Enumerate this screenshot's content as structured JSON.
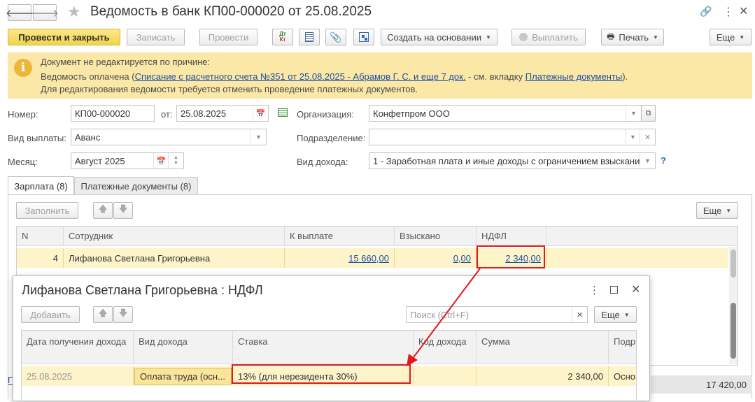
{
  "window": {
    "title": "Ведомость в банк КП00-000020 от 25.08.2025"
  },
  "toolbar": {
    "post_close": "Провести и закрыть",
    "save": "Записать",
    "post": "Провести",
    "create_based": "Создать на основании",
    "pay": "Выплатить",
    "print": "Печать",
    "more": "Еще"
  },
  "notice": {
    "line1": "Документ не редактируется по причине:",
    "line2_prefix": "Ведомость оплачена (",
    "line2_link": "Списание с расчетного счета №351 от 25.08.2025 - Абрамов Г. С. и еще 7 док.",
    "line2_mid": " - см. вкладку ",
    "line2_link2": "Платежные документы",
    "line2_suffix": ").",
    "line3": "Для редактирования ведомости требуется отменить проведение платежных документов."
  },
  "form": {
    "number_label": "Номер:",
    "number_value": "КП00-000020",
    "date_label": "от:",
    "date_value": "25.08.2025",
    "org_label": "Организация:",
    "org_value": "Конфетпром ООО",
    "payment_type_label": "Вид выплаты:",
    "payment_type_value": "Аванс",
    "subdivision_label": "Подразделение:",
    "subdivision_value": "",
    "month_label": "Месяц:",
    "month_value": "Август 2025",
    "income_type_label": "Вид дохода:",
    "income_type_value": "1 - Заработная плата и иные доходы с ограничением взыскания",
    "help": "?"
  },
  "tabs": [
    {
      "label": "Зарплата (8)"
    },
    {
      "label": "Платежные документы (8)"
    }
  ],
  "table_toolbar": {
    "fill": "Заполнить",
    "more": "Еще"
  },
  "table": {
    "columns": [
      "N",
      "Сотрудник",
      "К выплате",
      "Взыскано",
      "НДФЛ"
    ],
    "row": {
      "n": "4",
      "employee": "Лифанова Светлана Григорьевна",
      "to_pay": "15 660,00",
      "withheld": "0,00",
      "ndfl": "2 340,00"
    }
  },
  "footer": {
    "total": "17 420,00",
    "left_link": "Г"
  },
  "dialog": {
    "title": "Лифанова Светлана Григорьевна : НДФЛ",
    "add": "Добавить",
    "search_placeholder": "Поиск (Ctrl+F)",
    "more": "Еще",
    "columns": [
      "Дата получения дохода",
      "Вид дохода",
      "Ставка",
      "Код дохода",
      "Сумма",
      "Подр"
    ],
    "row": {
      "date": "25.08.2025",
      "income_type": "Оплата труда (осн...",
      "rate": "13% (для нерезидента 30%)",
      "code": "",
      "sum": "2 340,00",
      "sub": "Осно"
    }
  },
  "colors": {
    "accent": "#f2d34a",
    "notice_bg": "#fbe7a6",
    "highlight_row": "#fdf4c9",
    "annotation": "#e0191b"
  }
}
